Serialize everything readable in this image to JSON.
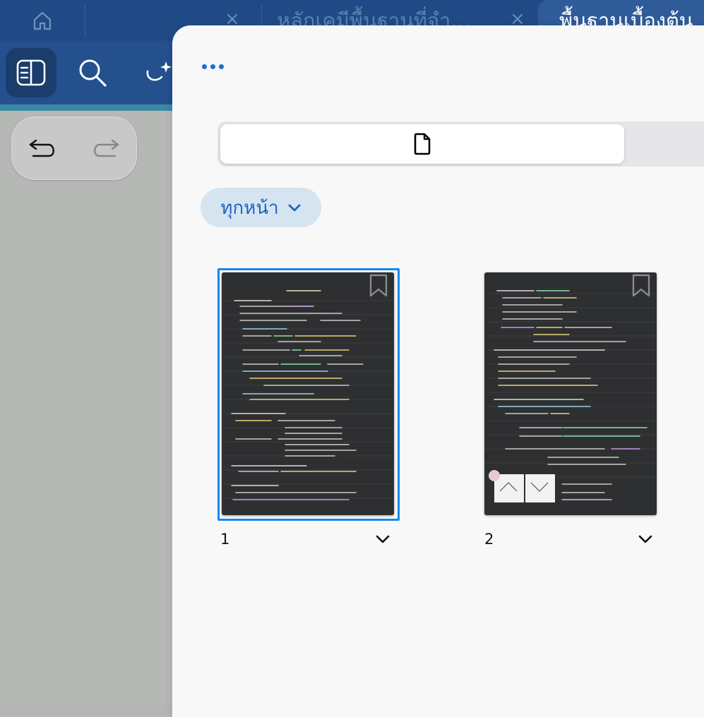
{
  "tabs": [
    {
      "title": "หลักเคมีพื้นฐานที่จำ...",
      "active": false
    },
    {
      "title": "พื้นฐานเบื้องต้น",
      "active": true
    }
  ],
  "toolbar": {
    "sidebar_icon": "sidebar-icon",
    "search_icon": "search-icon",
    "ai_icon": "sparkle-lasso-icon"
  },
  "undo_redo": {
    "undo_icon": "undo-icon",
    "redo_icon": "redo-icon"
  },
  "panel": {
    "more_icon": "ellipsis-icon",
    "segment_active_icon": "document-icon",
    "filter": {
      "label": "ทุกหน้า",
      "icon": "chevron-down-icon"
    },
    "pages": [
      {
        "number": "1",
        "selected": true,
        "bookmark_icon": "bookmark-icon"
      },
      {
        "number": "2",
        "selected": false,
        "bookmark_icon": "bookmark-icon"
      }
    ]
  },
  "colors": {
    "tabbar": "#1f4a86",
    "toolbar": "#24508e",
    "accent": "#1786f0",
    "filter_bg": "#d5e4f1",
    "filter_text": "#1a65c0"
  }
}
